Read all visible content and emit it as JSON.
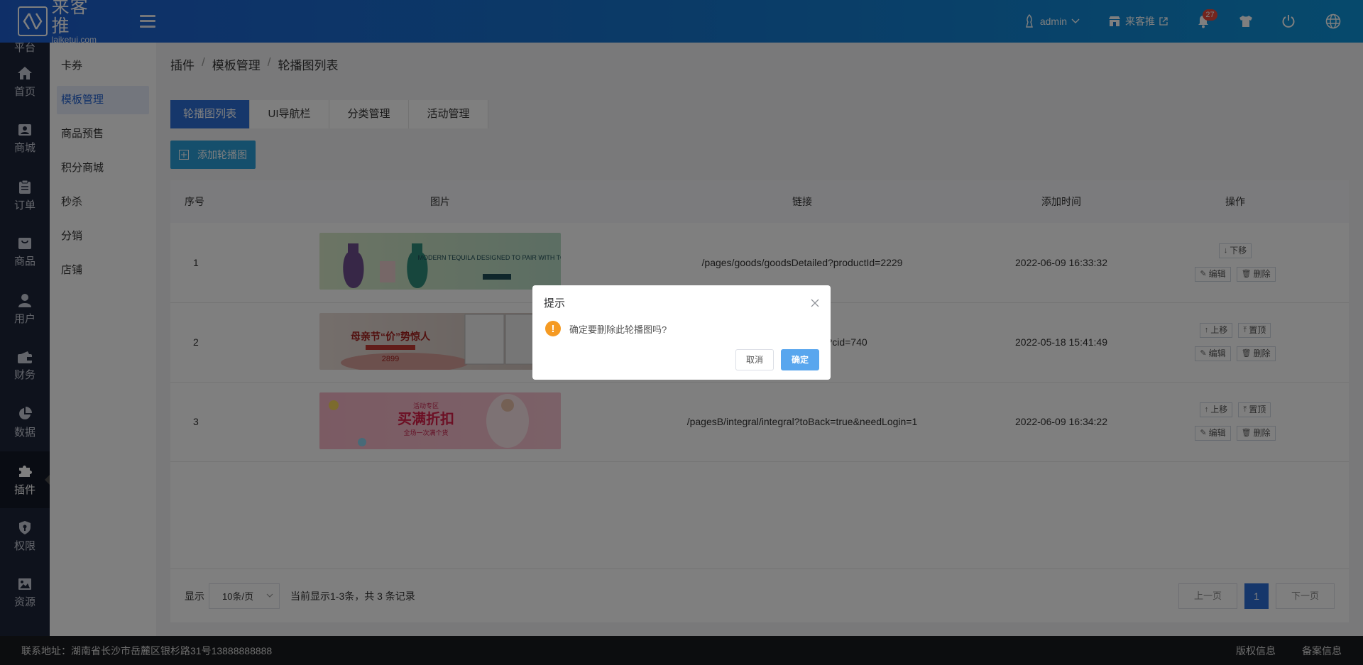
{
  "header": {
    "logo_cn": "来客推",
    "logo_en": "laiketui.com",
    "user": "admin",
    "store": "来客推",
    "notification_count": "27"
  },
  "sidebar": {
    "items": [
      {
        "label": "平台",
        "icon": "platform-icon"
      },
      {
        "label": "首页",
        "icon": "home-icon"
      },
      {
        "label": "商城",
        "icon": "store-icon"
      },
      {
        "label": "订单",
        "icon": "clipboard-icon"
      },
      {
        "label": "商品",
        "icon": "product-icon"
      },
      {
        "label": "用户",
        "icon": "user-icon"
      },
      {
        "label": "财务",
        "icon": "wallet-icon"
      },
      {
        "label": "数据",
        "icon": "pie-chart-icon"
      },
      {
        "label": "插件",
        "icon": "puzzle-icon"
      },
      {
        "label": "权限",
        "icon": "shield-icon"
      },
      {
        "label": "资源",
        "icon": "image-icon"
      }
    ]
  },
  "subnav": {
    "items": [
      "卡券",
      "模板管理",
      "商品预售",
      "积分商城",
      "秒杀",
      "分销",
      "店铺"
    ]
  },
  "breadcrumb": [
    "插件",
    "模板管理",
    "轮播图列表"
  ],
  "tabs": [
    "轮播图列表",
    "UI导航栏",
    "分类管理",
    "活动管理"
  ],
  "add_button": "添加轮播图",
  "table": {
    "columns": [
      "序号",
      "图片",
      "链接",
      "添加时间",
      "操作"
    ],
    "rows": [
      {
        "index": "1",
        "link": "/pages/goods/goodsDetailed?productId=2229",
        "time": "2022-06-09 16:33:32"
      },
      {
        "index": "2",
        "link": "/pages/goods/goods?cid=740",
        "time": "2022-05-18 15:41:49"
      },
      {
        "index": "3",
        "link": "/pagesB/integral/integral?toBack=true&needLogin=1",
        "time": "2022-06-09 16:34:22"
      }
    ],
    "ops": {
      "move_down": "下移",
      "move_up": "上移",
      "top": "置顶",
      "edit": "编辑",
      "delete": "删除"
    }
  },
  "banners": {
    "b1": "MODERN TEQUILA DESIGNED TO PAIR WITH TONIC",
    "b2": "母亲节“价”势惊人",
    "b2_price": "2899",
    "b3": "买满折扣",
    "b3_top": "活动专区",
    "b3_sub": "全场一次满个货"
  },
  "pager": {
    "show_label": "显示",
    "page_size": "10条/页",
    "records": "当前显示1-3条，共 3 条记录",
    "prev": "上一页",
    "current": "1",
    "next": "下一页"
  },
  "footer": {
    "address": "联系地址：湖南省长沙市岳麓区银杉路31号13888888888",
    "copyright": "版权信息",
    "icp": "备案信息"
  },
  "dialog": {
    "title": "提示",
    "message": "确定要删除此轮播图吗?",
    "cancel": "取消",
    "confirm": "确定"
  }
}
